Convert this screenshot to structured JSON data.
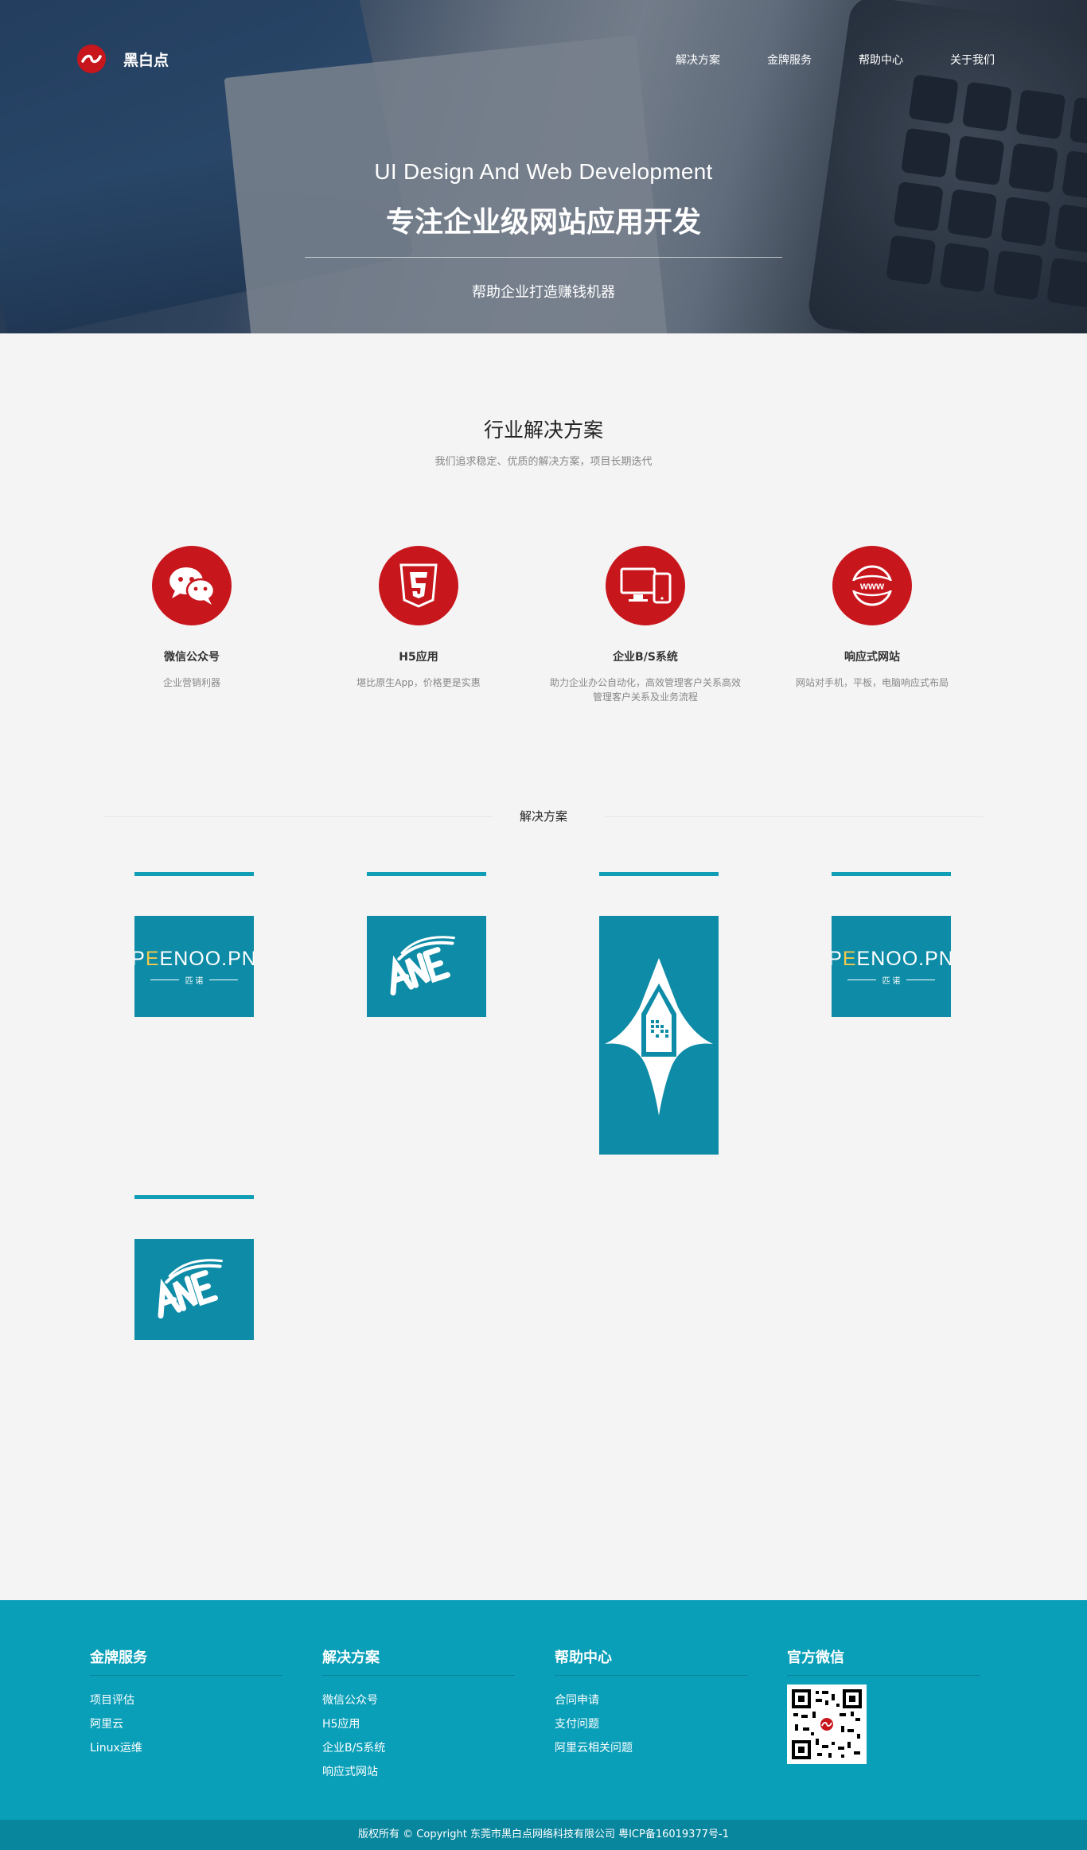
{
  "brand": {
    "name": "黑白点"
  },
  "nav": {
    "items": [
      "解决方案",
      "金牌服务",
      "帮助中心",
      "关于我们"
    ]
  },
  "hero": {
    "title_en": "UI Design And Web Development",
    "title_cn": "专注企业级网站应用开发",
    "subtitle": "帮助企业打造赚钱机器"
  },
  "industry": {
    "title": "行业解决方案",
    "subtitle": "我们追求稳定、优质的解决方案，项目长期迭代",
    "features": [
      {
        "icon": "wechat-icon",
        "title": "微信公众号",
        "desc": "企业营销利器"
      },
      {
        "icon": "html5-icon",
        "title": "H5应用",
        "desc": "堪比原生App，价格更是实惠"
      },
      {
        "icon": "devices-icon",
        "title": "企业B/S系统",
        "desc": "助力企业办公自动化，高效管理客户关系高效管理客户关系及业务流程"
      },
      {
        "icon": "www-globe-icon",
        "title": "响应式网站",
        "desc": "网站对手机，平板，电脑响应式布局"
      }
    ]
  },
  "solutions": {
    "title": "解决方案",
    "cards": [
      {
        "logo": "peenoo-logo",
        "brand_text": "PEENOO.PN",
        "brand_cn": "匹 诺"
      },
      {
        "logo": "stylized-script-logo"
      },
      {
        "logo": "house-emblem-logo"
      },
      {
        "logo": "peenoo-logo",
        "brand_text": "PEENOO.PN",
        "brand_cn": "匹 诺"
      },
      {
        "logo": "stylized-script-logo"
      }
    ],
    "accent": "#0f9eb5",
    "card_bg": "#0e8ba6"
  },
  "footer": {
    "cols": [
      {
        "title": "金牌服务",
        "items": [
          "项目评估",
          "阿里云",
          "Linux运维"
        ]
      },
      {
        "title": "解决方案",
        "items": [
          "微信公众号",
          "H5应用",
          "企业B/S系统",
          "响应式网站"
        ]
      },
      {
        "title": "帮助中心",
        "items": [
          "合同申请",
          "支付问题",
          "阿里云相关问题"
        ]
      },
      {
        "title": "官方微信",
        "items": []
      }
    ],
    "copyright": "版权所有 © Copyright 东莞市黑白点网络科技有限公司 粤ICP备16019377号-1",
    "bg": "#0a9fb9"
  },
  "colors": {
    "brand_red": "#c8161d",
    "page_bg": "#f4f4f4"
  }
}
